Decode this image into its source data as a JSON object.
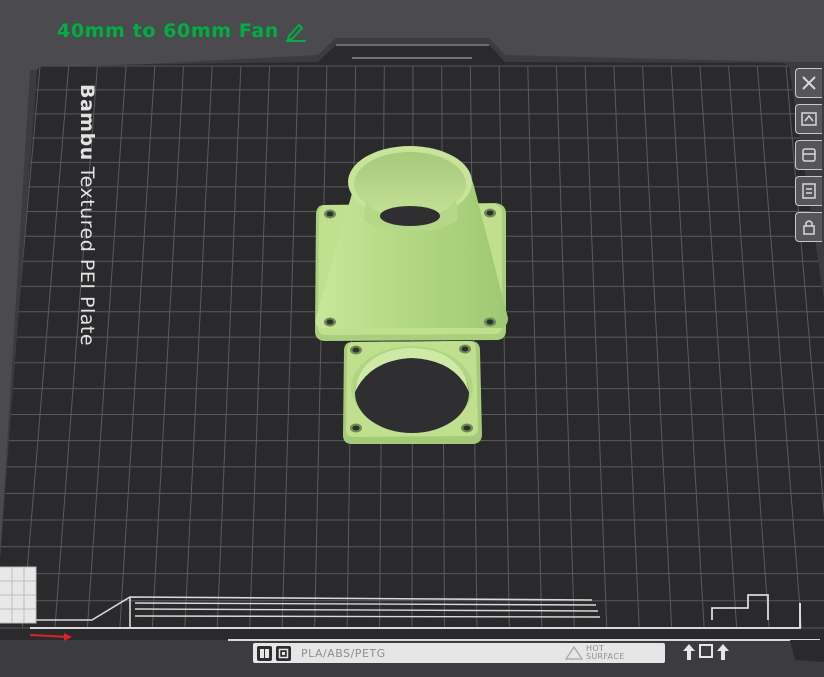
{
  "project": {
    "title": "40mm to 60mm Fan",
    "edit_icon": "pencil-icon"
  },
  "plate": {
    "brand": "Bambu",
    "name": "Textured PEI Plate"
  },
  "toolbar": {
    "items": [
      {
        "name": "close-plate-icon"
      },
      {
        "name": "auto-orient-icon"
      },
      {
        "name": "arrange-icon"
      },
      {
        "name": "plate-settings-icon"
      },
      {
        "name": "lock-icon"
      }
    ]
  },
  "bed_info": {
    "filament_types": "PLA/ABS/PETG",
    "warning": "HOT\nSURFACE"
  },
  "colors": {
    "title_green": "#00ae42",
    "model_green": "#b9df86",
    "plate": "#2a2a2d",
    "grid": "#5a5a5e"
  }
}
